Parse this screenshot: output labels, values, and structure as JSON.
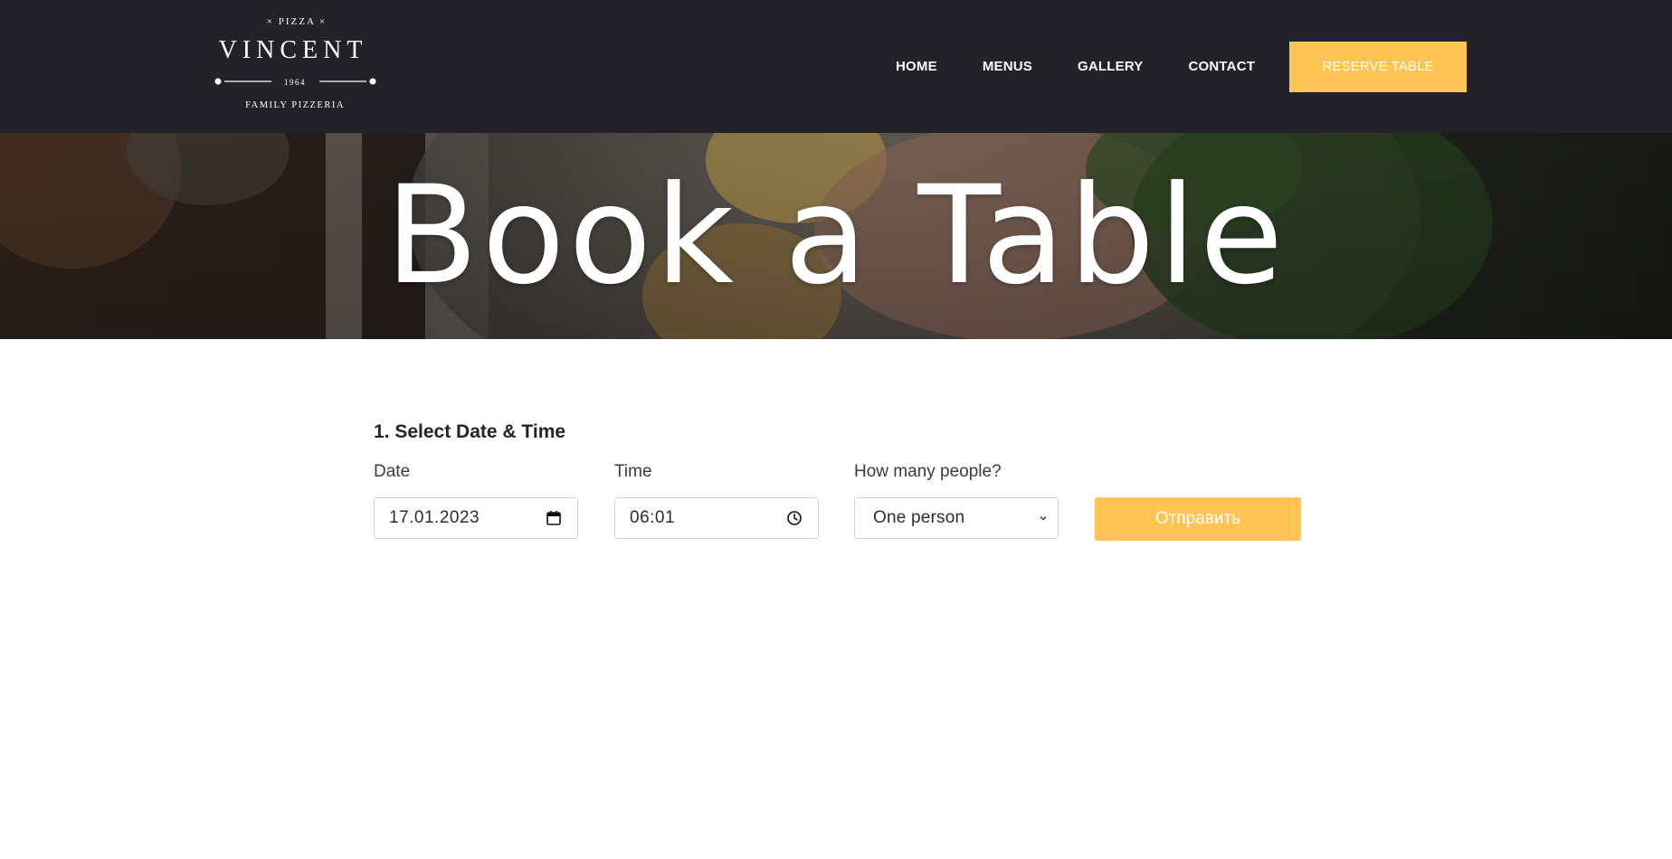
{
  "logo": {
    "top_line": "× PIZZA ×",
    "name": "VINCENT",
    "year": "1964",
    "tagline": "FAMILY PIZZERIA"
  },
  "nav": {
    "items": [
      {
        "label": "HOME"
      },
      {
        "label": "MENUS"
      },
      {
        "label": "GALLERY"
      },
      {
        "label": "CONTACT"
      }
    ],
    "reserve_label": "RESERVE TABLE"
  },
  "hero": {
    "title": "Book a Table"
  },
  "form": {
    "section_title": "1. Select Date & Time",
    "date": {
      "label": "Date",
      "value": "17.01.2023",
      "icon": "calendar-icon"
    },
    "time": {
      "label": "Time",
      "value": "06:01",
      "icon": "clock-icon"
    },
    "people": {
      "label": "How many people?",
      "selected": "One person",
      "icon": "chevron-down-icon"
    },
    "submit_label": "Отправить"
  },
  "colors": {
    "header_bg": "#232228",
    "accent": "#ffc454",
    "text": "#23232a"
  }
}
